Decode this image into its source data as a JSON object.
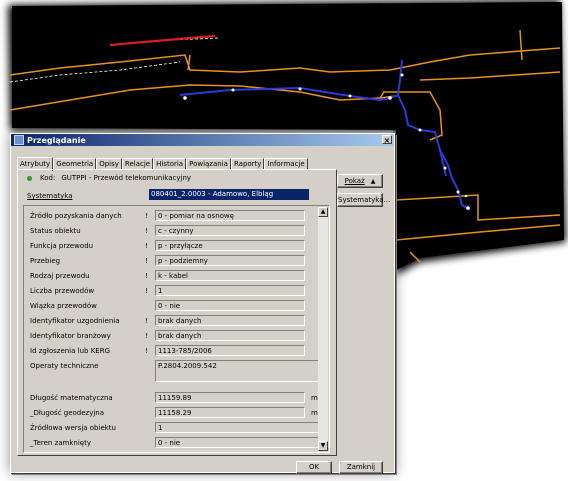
{
  "dialog": {
    "title": "Przeglądanie",
    "close_glyph": "×",
    "tabs": [
      "Atrybuty",
      "Geometria",
      "Opisy",
      "Relacje",
      "Historia",
      "Powiązania",
      "Raporty",
      "Informacje"
    ],
    "kod_label": "Kod:",
    "kod_value": "GUTPPI - Przewód telekomunikacyjny",
    "systematyka_label": "Systematyka",
    "systematyka_value": "080401_2.0003 - Adamowo, Elbląg",
    "buttons": {
      "pokaz": "Pokaż",
      "systematyka": "Systematyka...",
      "ok": "OK",
      "zamknij": "Zamknij"
    },
    "icons": {
      "pokaz_arrow": "▲",
      "scroll_up": "▲",
      "scroll_down": "▼",
      "status_dot": "green-dot"
    },
    "attributes": [
      {
        "label": "Źródło pozyskania danych",
        "required": "!",
        "value": "0 - pomiar na osnowę"
      },
      {
        "label": "Status obiektu",
        "required": "!",
        "value": "c - czynny"
      },
      {
        "label": "Funkcja przewodu",
        "required": "!",
        "value": "p - przyłącze"
      },
      {
        "label": "Przebieg",
        "required": "!",
        "value": "p - podziemny"
      },
      {
        "label": "Rodzaj przewodu",
        "required": "!",
        "value": "k - kabel"
      },
      {
        "label": "Liczba przewodów",
        "required": "!",
        "value": "1"
      },
      {
        "label": "Wiązka przewodów",
        "required": "",
        "value": "0 - nie"
      },
      {
        "label": "Identyfikator uzgodnienia",
        "required": "!",
        "value": "brak danych"
      },
      {
        "label": "Identyfikator branżowy",
        "required": "!",
        "value": "brak danych"
      },
      {
        "label": "Id zgłoszenia lub KERG",
        "required": "!",
        "value": "1113-785/2006"
      },
      {
        "label": "Operaty techniczne",
        "required": "",
        "value": "P.2804.2009.542"
      }
    ],
    "measures": [
      {
        "label": "Długość matematyczna",
        "value": "11159.89",
        "unit": "m"
      },
      {
        "label": "_Długość geodezyjna",
        "value": "11158.29",
        "unit": "m"
      },
      {
        "label": "Źródłowa wersja obiektu",
        "value": "1",
        "unit": ""
      },
      {
        "label": "_Teren zamknięty",
        "value": "0 - nie",
        "unit": ""
      }
    ]
  },
  "colors": {
    "map_background": "#000000",
    "line_orange": "#e8921e",
    "line_blue": "#2a3ad8",
    "line_red": "#d81e1e",
    "title_bar": "#0a246a",
    "dialog_face": "#d4d0c8"
  }
}
